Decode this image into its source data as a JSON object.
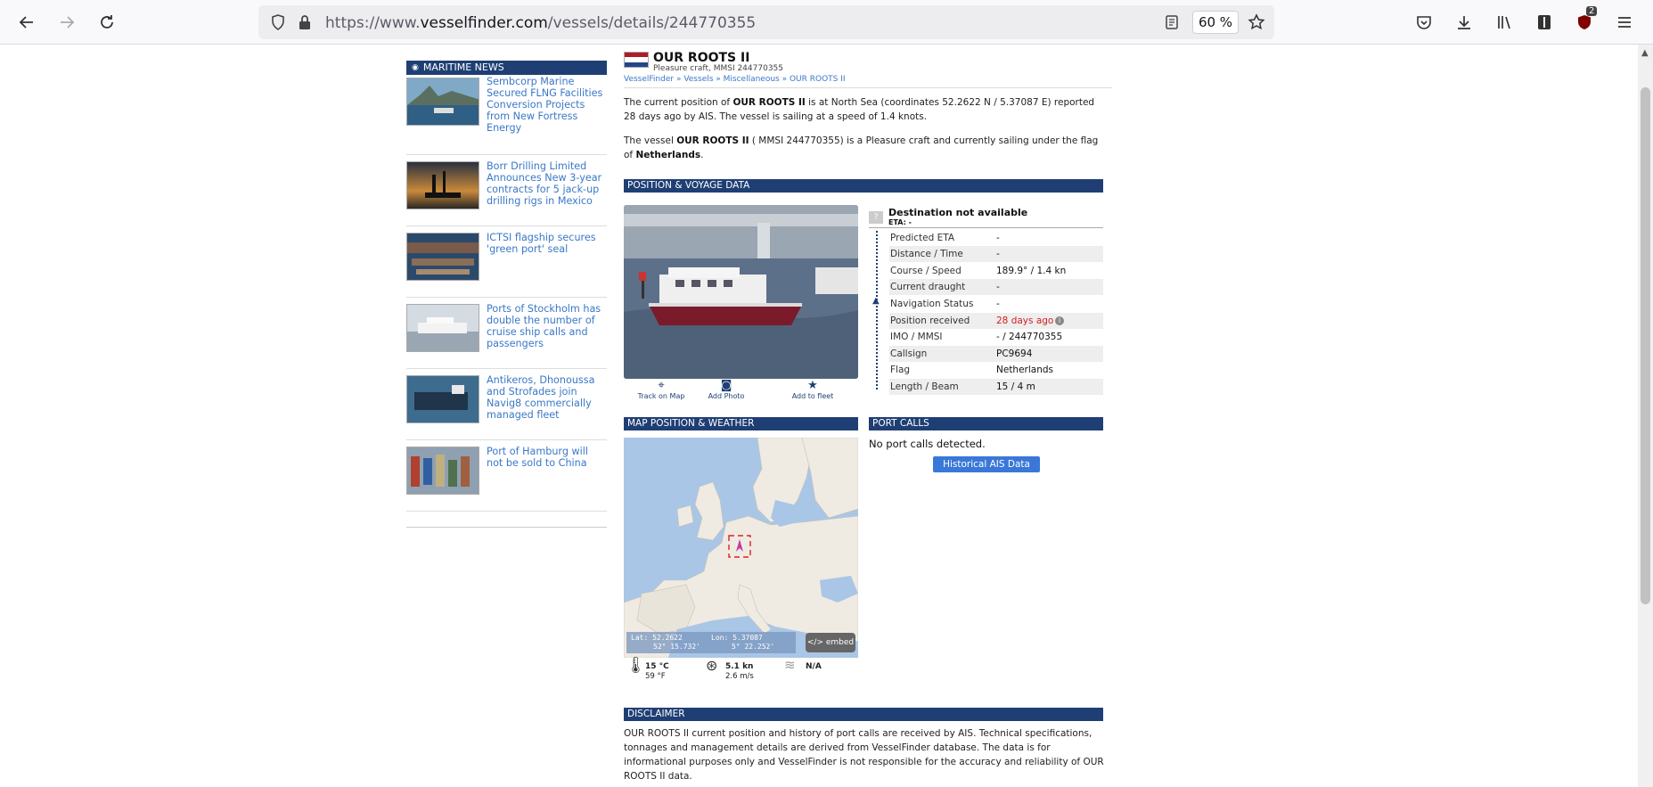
{
  "browser": {
    "url_prefix": "https://www.",
    "url_domain": "vesselfinder.com",
    "url_path": "/vessels/details/244770355",
    "zoom": "60 %",
    "ublock_count": "2"
  },
  "sidebar": {
    "header": "MARITIME NEWS",
    "news": [
      {
        "title": "Sembcorp Marine Secured FLNG Facilities Conversion Projects from New Fortress Energy"
      },
      {
        "title": "Borr Drilling Limited Announces New 3-year contracts for 5 jack-up drilling rigs in Mexico"
      },
      {
        "title": "ICTSI flagship secures 'green port' seal"
      },
      {
        "title": "Ports of Stockholm has double the number of cruise ship calls and passengers"
      },
      {
        "title": "Antikeros, Dhonoussa and Strofades join Navig8 commercially managed fleet"
      },
      {
        "title": "Port of Hamburg will not be sold to China"
      }
    ]
  },
  "vessel": {
    "name": "OUR ROOTS II",
    "subtitle": "Pleasure craft, MMSI 244770355",
    "breadcrumb": "VesselFinder » Vessels » Miscellaneous » OUR ROOTS II",
    "p1_a": "The current position of ",
    "p1_name": "OUR ROOTS II",
    "p1_b": " is at North Sea (coordinates 52.2622 N / 5.37087 E) reported 28 days ago by AIS. The vessel is sailing at a speed of 1.4 knots.",
    "p2_a": "The vessel ",
    "p2_name": "OUR ROOTS II",
    "p2_b": " ( MMSI 244770355) is a Pleasure craft and currently sailing under the flag of ",
    "p2_flag": "Netherlands",
    "p2_c": "."
  },
  "voyage": {
    "header": "POSITION & VOYAGE DATA",
    "actions": {
      "track": "Track on Map",
      "photo": "Add Photo",
      "fleet": "Add to fleet"
    },
    "dest_title": "Destination not available",
    "dest_eta": "ETA: -",
    "dest_q": "?",
    "rows": [
      {
        "k": "Predicted ETA",
        "v": "-"
      },
      {
        "k": "Distance / Time",
        "v": "-"
      },
      {
        "k": "Course / Speed",
        "v": "189.9° / 1.4 kn"
      },
      {
        "k": "Current draught",
        "v": "-"
      },
      {
        "k": "Navigation Status",
        "v": "-"
      },
      {
        "k": "Position received",
        "v": "28 days ago"
      },
      {
        "k": "IMO / MMSI",
        "v": "- / 244770355"
      },
      {
        "k": "Callsign",
        "v": "PC9694"
      },
      {
        "k": "Flag",
        "v": "Netherlands"
      },
      {
        "k": "Length / Beam",
        "v": "15 / 4 m"
      }
    ]
  },
  "map": {
    "header": "MAP POSITION & WEATHER",
    "lat": "Lat: 52.2622",
    "lat_dms": "52° 15.732'",
    "lon": "Lon: 5.37087",
    "lon_dms": "5° 22.252'",
    "embed": "</> embed",
    "temp_c": "15 °C",
    "temp_f": "59 °F",
    "wind_kn": "5.1 kn",
    "wind_ms": "2.6 m/s",
    "waves": "N/A"
  },
  "port_calls": {
    "header": "PORT CALLS",
    "text": "No port calls detected.",
    "button": "Historical AIS Data"
  },
  "disclaimer": {
    "header": "DISCLAIMER",
    "text": "OUR ROOTS II current position and history of port calls are received by AIS. Technical specifications, tonnages and management details are derived from VesselFinder database. The data is for informational purposes only and VesselFinder is not responsible for the accuracy and reliability of OUR ROOTS II data."
  },
  "colors": {
    "section_header": "#1f3f74",
    "link": "#3a78c8",
    "button": "#3a78d8",
    "alert": "#d02020"
  }
}
